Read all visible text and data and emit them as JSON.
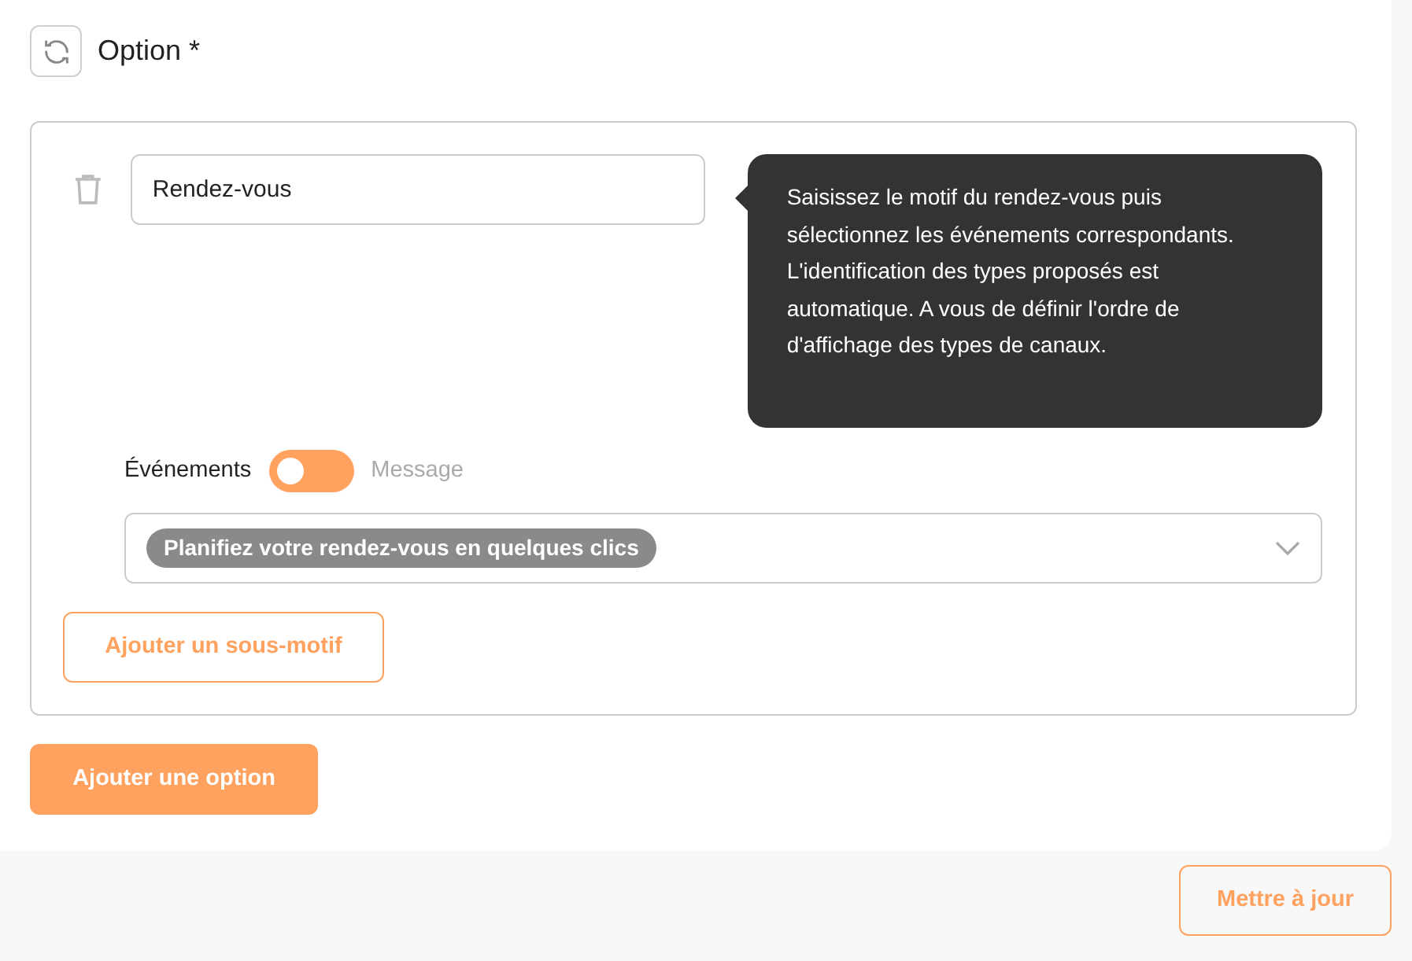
{
  "header": {
    "title": "Option *"
  },
  "option": {
    "input_value": "Rendez-vous",
    "tooltip": "Saisissez le motif du rendez-vous puis sélectionnez les événements correspondants. L'identification des types proposés est automatique. A vous de définir l'ordre de d'affichage des types de canaux.",
    "toggle": {
      "left_label": "Événements",
      "right_label": "Message",
      "on": false
    },
    "select_tags": [
      "Planifiez votre rendez-vous en quelques clics"
    ],
    "sub_button": "Ajouter un sous-motif"
  },
  "add_button": "Ajouter une option",
  "update_button": "Mettre à jour"
}
